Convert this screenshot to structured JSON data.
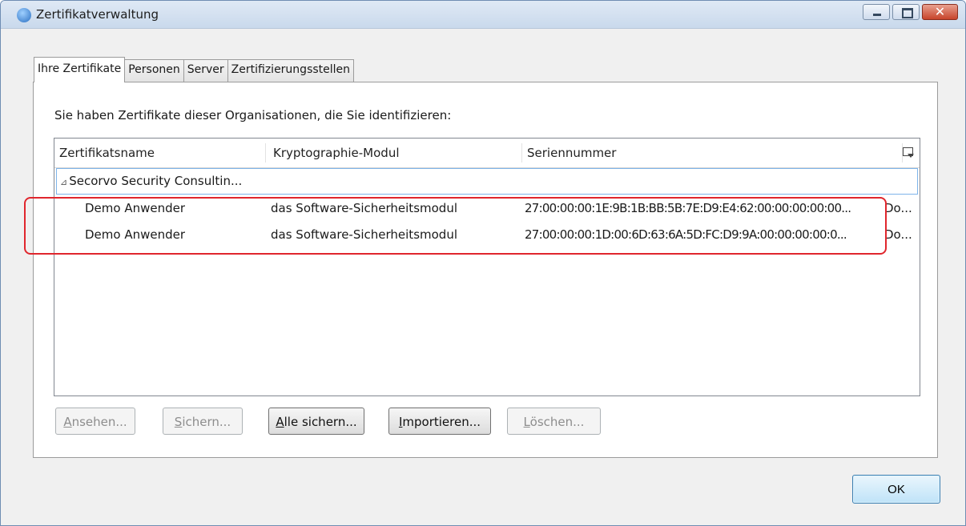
{
  "window": {
    "title": "Zertifikatverwaltung",
    "close_glyph": "✕"
  },
  "tabs": [
    {
      "label": "Ihre Zertifikate",
      "active": true
    },
    {
      "label": "Personen",
      "active": false
    },
    {
      "label": "Server",
      "active": false
    },
    {
      "label": "Zertifizierungsstellen",
      "active": false
    }
  ],
  "prompt": "Sie haben Zertifikate dieser Organisationen, die Sie identifizieren:",
  "table": {
    "columns": [
      "Zertifikatsname",
      "Kryptographie-Modul",
      "Seriennummer"
    ],
    "group": {
      "twisty": "⊿",
      "label": "Secorvo Security Consultin..."
    },
    "rows": [
      {
        "name": "Demo Anwender",
        "module": "das Software-Sicherheitsmodul",
        "serial": "27:00:00:00:1E:9B:1B:BB:5B:7E:D9:E4:62:00:00:00:00:00...",
        "extra": "Do..."
      },
      {
        "name": "Demo Anwender",
        "module": "das Software-Sicherheitsmodul",
        "serial": "27:00:00:00:1D:00:6D:63:6A:5D:FC:D9:9A:00:00:00:00:0...",
        "extra": "Do..."
      }
    ]
  },
  "buttons": {
    "view": {
      "first": "A",
      "rest": "nsehen..."
    },
    "backup": {
      "first": "S",
      "rest": "ichern..."
    },
    "backup_all": {
      "first": "A",
      "rest": "lle sichern..."
    },
    "import": {
      "first": "I",
      "rest": "mportieren..."
    },
    "delete": {
      "first": "L",
      "rest": "öschen..."
    }
  },
  "ok": "OK",
  "colors": {
    "highlight": "#e0262d",
    "accent": "#3c7fb1"
  }
}
